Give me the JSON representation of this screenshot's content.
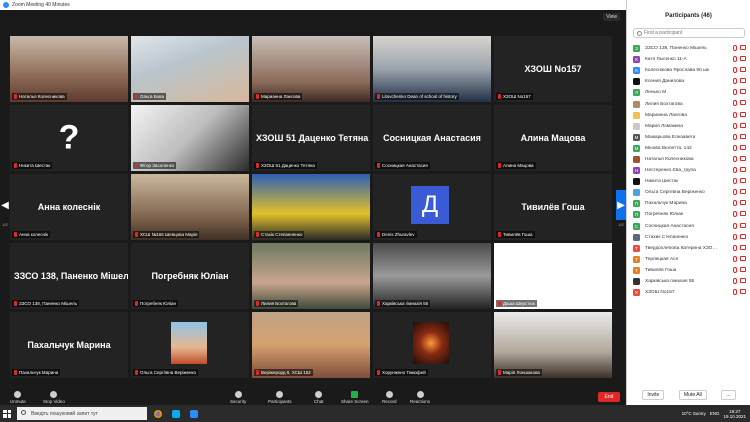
{
  "window": {
    "title": "Zoom Meeting 40 Minutes",
    "view_label": "View"
  },
  "tiles": [
    {
      "label": "Наталья Колесникова",
      "photo": "ph-a"
    },
    {
      "label": "Ольга Бова",
      "photo": "ph-b"
    },
    {
      "label": "Марианна Лангова",
      "photo": "ph-c"
    },
    {
      "label": "Litovchenko Dean of school of history",
      "photo": "ph-d",
      "muted": false
    },
    {
      "label": "ХЗОШ No157",
      "bigname": "ХЗОШ No157"
    },
    {
      "label": "Никита Шестак",
      "bigname": "?",
      "q": true
    },
    {
      "label": "Фігор Засоленко",
      "photo": "ph-e"
    },
    {
      "label": "ХЗОШ 51 Даценко Тетяна",
      "bigname": "ХЗОШ 51 Даценко Тетяна"
    },
    {
      "label": "Сосницкая Анастасия",
      "bigname": "Сосницкая Анастасия"
    },
    {
      "label": "Алина Мацова",
      "bigname": "Алина Мацова"
    },
    {
      "label": "Анна колеснік",
      "bigname": "Анна колеснік"
    },
    {
      "label": "ХСШ №166 Шевцова Марія",
      "photo": "ph-f"
    },
    {
      "label": "Стахік Степанненко",
      "photo": "ph-g"
    },
    {
      "label": "Denis Zhuravlev",
      "avatar": "Д"
    },
    {
      "label": "Тивилёв Гоша",
      "bigname": "Тивилёв Гоша"
    },
    {
      "label": "ЗЗСО 138, Паненко Мішель",
      "bigname": "ЗЗСО 138, Паненко Мішель"
    },
    {
      "label": "Погребняк Юліан",
      "bigname": "Погребняк Юліан"
    },
    {
      "label": "Лилия Бохтагова",
      "photo": "ph-h"
    },
    {
      "label": "Харківська гімназія 55",
      "photo": "ph-i"
    },
    {
      "label": "Даша Шерстюк",
      "photo": "ph-j"
    },
    {
      "label": "Пахальчук Марина",
      "bigname": "Пахальчук Марина"
    },
    {
      "label": "Ольга Сергіївна Веріженко",
      "photo": "ph-k",
      "small": true
    },
    {
      "label": "Веріжерорд 8, ХСШ 152",
      "photo": "ph-l"
    },
    {
      "label": "Хорунжено Тимофей",
      "photo": "ph-m",
      "small": true
    },
    {
      "label": "Марія Лоншакова",
      "photo": "ph-n"
    }
  ],
  "pager": {
    "left": "1/2",
    "right": "1/2"
  },
  "toolbar": {
    "unmute": "Unmute",
    "stop_video": "Stop Video",
    "security": "Security",
    "participants": "Participants",
    "participants_count": "46",
    "chat": "Chat",
    "share_screen": "Share Screen",
    "record": "Record",
    "reactions": "Reactions",
    "end": "End"
  },
  "panel": {
    "title": "Participants (46)",
    "search_placeholder": "Find a participant",
    "participants": [
      {
        "name": "ЗЗСО 138, Паненко Мішель",
        "initial": "З",
        "color": "#3aa757"
      },
      {
        "name": "Катя Лысенко 11-А",
        "initial": "К",
        "color": "#8e44ad"
      },
      {
        "name": "Колеснікова Ярослава 9б шк",
        "initial": "К",
        "color": "#2d8cff"
      },
      {
        "name": "Ксения Данилова",
        "initial": "",
        "color": "#111111"
      },
      {
        "name": "Ленько М",
        "initial": "Л",
        "color": "#3aa757"
      },
      {
        "name": "Лилия Бохтагова",
        "initial": "",
        "color": "#b08a6a"
      },
      {
        "name": "Марианна Лангова",
        "initial": "",
        "color": "#f2c14e"
      },
      {
        "name": "Мария Ломакина",
        "initial": "",
        "color": "#c9c9c9"
      },
      {
        "name": "Мажарьова Елизавета",
        "initial": "М",
        "color": "#555555"
      },
      {
        "name": "Мінова Віолетта, 142",
        "initial": "М",
        "color": "#3aa757"
      },
      {
        "name": "Наталья Колесникова",
        "initial": "",
        "color": "#a0522d"
      },
      {
        "name": "Нестеренко Єва_група",
        "initial": "Н",
        "color": "#8e44ad"
      },
      {
        "name": "Никита Шестак",
        "initial": "",
        "color": "#111111"
      },
      {
        "name": "Ольга Сергіївна Веріженко",
        "initial": "",
        "color": "#4aa3df"
      },
      {
        "name": "Пахальчук Марина",
        "initial": "П",
        "color": "#3aa757"
      },
      {
        "name": "Погребняк Юліан",
        "initial": "П",
        "color": "#3aa757"
      },
      {
        "name": "Сосницкая Анастасия",
        "initial": "С",
        "color": "#3aa757"
      },
      {
        "name": "Стахик Степаненко",
        "initial": "",
        "color": "#5a6a7a"
      },
      {
        "name": "Твердохлебова Катерина ХЗО…",
        "initial": "Т",
        "color": "#e74c3c"
      },
      {
        "name": "Терлецкая Ася",
        "initial": "Т",
        "color": "#e67e22"
      },
      {
        "name": "Тивилёв Гоша",
        "initial": "Т",
        "color": "#e67e22"
      },
      {
        "name": "Харківська гімназія 55",
        "initial": "",
        "color": "#333333"
      },
      {
        "name": "ХЗОШ No157",
        "initial": "Х",
        "color": "#e74c3c"
      }
    ],
    "invite": "Invite",
    "mute_all": "Mute All",
    "more": "..."
  },
  "taskbar": {
    "search_placeholder": "Введіть пошуковий запит тут",
    "weather": "10°C  Sunny",
    "lang": "ENG",
    "time": "19:27",
    "date": "19.10.2021"
  }
}
